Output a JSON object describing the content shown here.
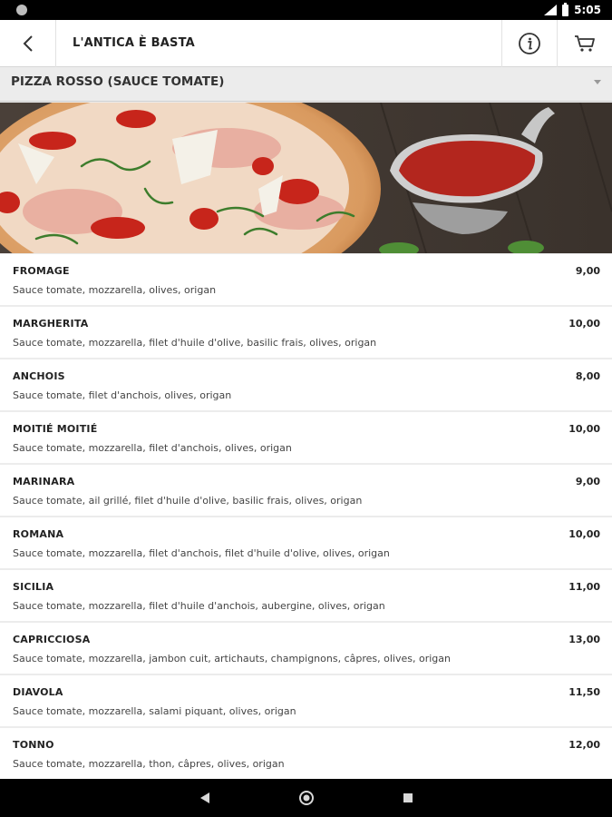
{
  "status_bar": {
    "time": "5:05"
  },
  "header": {
    "title": "L'ANTICA È BASTA",
    "icons": {
      "back": "arrow-back-icon",
      "info": "info-icon",
      "cart": "cart-icon"
    }
  },
  "category": {
    "label": "PIZZA ROSSO (SAUCE TOMATE)"
  },
  "menu_items": [
    {
      "name": "FROMAGE",
      "price": "9,00",
      "description": "Sauce tomate, mozzarella, olives, origan"
    },
    {
      "name": "MARGHERITA",
      "price": "10,00",
      "description": "Sauce tomate, mozzarella, filet d'huile d'olive, basilic frais, olives, origan"
    },
    {
      "name": "ANCHOIS",
      "price": "8,00",
      "description": "Sauce tomate, filet d'anchois, olives, origan"
    },
    {
      "name": "MOITIÉ MOITIÉ",
      "price": "10,00",
      "description": "Sauce tomate, mozzarella, filet d'anchois, olives, origan"
    },
    {
      "name": "MARINARA",
      "price": "9,00",
      "description": "Sauce tomate, ail grillé, filet d'huile d'olive, basilic frais, olives, origan"
    },
    {
      "name": "ROMANA",
      "price": "10,00",
      "description": "Sauce tomate, mozzarella, filet d'anchois, filet d'huile d'olive, olives, origan"
    },
    {
      "name": "SICILIA",
      "price": "11,00",
      "description": "Sauce tomate, mozzarella, filet d'huile d'anchois, aubergine, olives, origan"
    },
    {
      "name": "CAPRICCIOSA",
      "price": "13,00",
      "description": "Sauce tomate, mozzarella, jambon cuit, artichauts, champignons, câpres, olives, origan"
    },
    {
      "name": "DIAVOLA",
      "price": "11,50",
      "description": "Sauce tomate, mozzarella, salami piquant, olives, origan"
    },
    {
      "name": "TONNO",
      "price": "12,00",
      "description": "Sauce tomate, mozzarella, thon, câpres, olives, origan"
    }
  ],
  "colors": {
    "accent": "#222222",
    "background": "#ececec",
    "card": "#ffffff",
    "sauce": "#b3261e"
  }
}
